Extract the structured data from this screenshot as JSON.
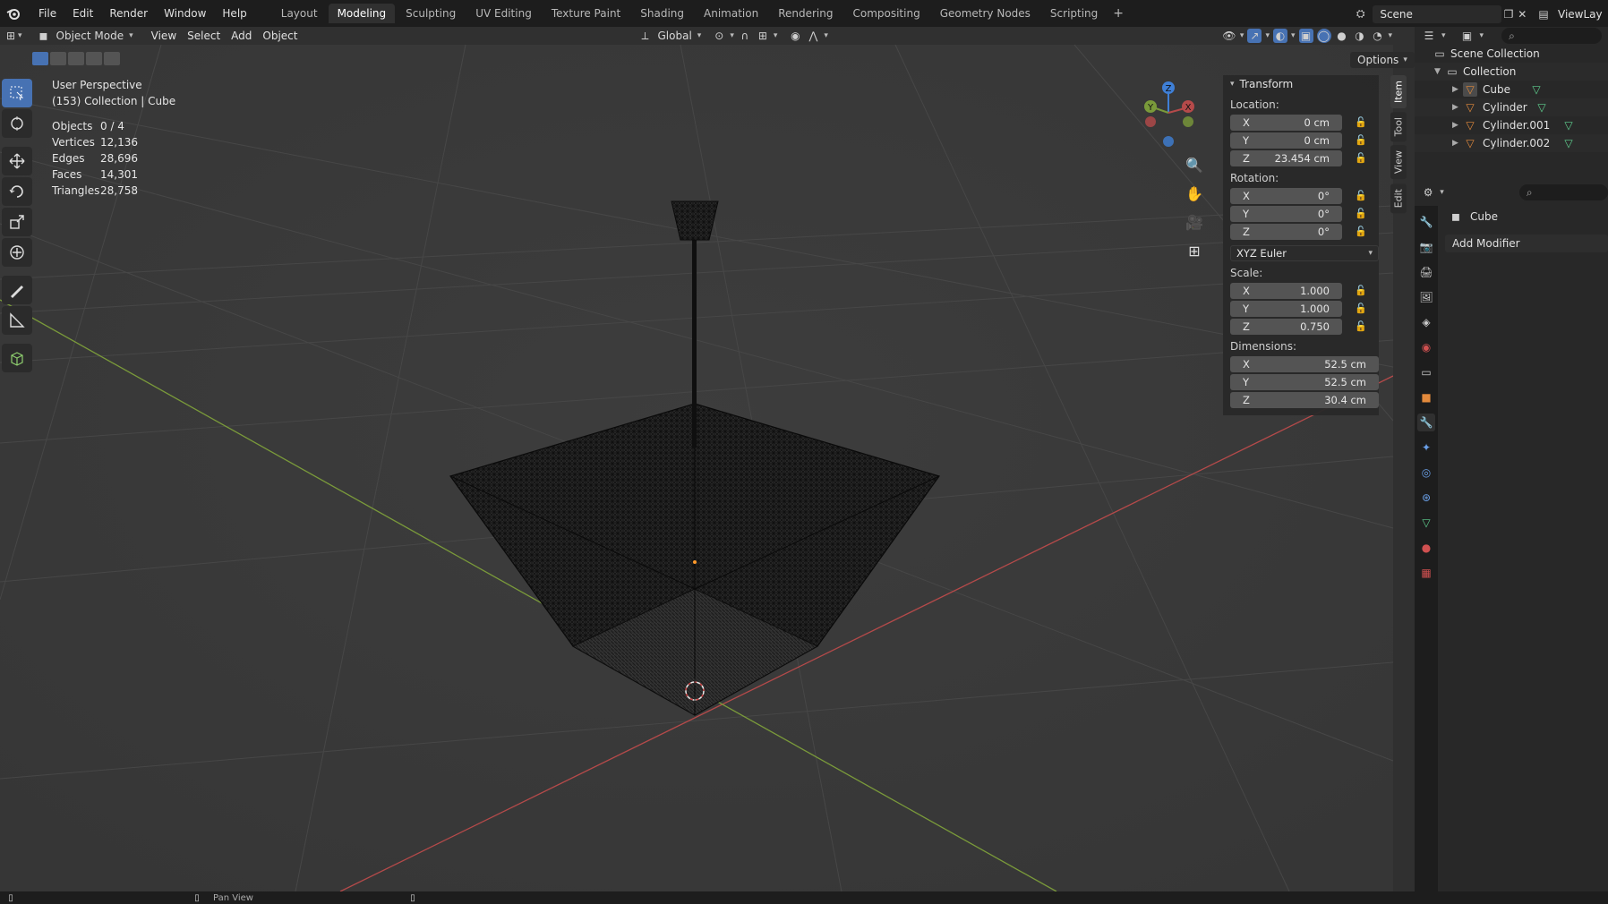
{
  "topbar": {
    "menus": [
      "File",
      "Edit",
      "Render",
      "Window",
      "Help"
    ],
    "workspaces": [
      "Layout",
      "Modeling",
      "Sculpting",
      "UV Editing",
      "Texture Paint",
      "Shading",
      "Animation",
      "Rendering",
      "Compositing",
      "Geometry Nodes",
      "Scripting"
    ],
    "active_workspace": "Modeling",
    "scene_name": "Scene",
    "view_layer": "ViewLay"
  },
  "viewport_header": {
    "mode": "Object Mode",
    "menus": [
      "View",
      "Select",
      "Add",
      "Object"
    ],
    "transform_orientation": "Global"
  },
  "viewport_overlay": {
    "perspective": "User Perspective",
    "context": "(153) Collection | Cube",
    "stats": [
      {
        "label": "Objects",
        "value": "0 / 4"
      },
      {
        "label": "Vertices",
        "value": "12,136"
      },
      {
        "label": "Edges",
        "value": "28,696"
      },
      {
        "label": "Faces",
        "value": "14,301"
      },
      {
        "label": "Triangles",
        "value": "28,758"
      }
    ]
  },
  "gizmo_labels": {
    "x": "X",
    "y": "Y",
    "z": "Z"
  },
  "options_label": "Options",
  "n_panel": {
    "title": "Transform",
    "location_label": "Location:",
    "location": [
      {
        "axis": "X",
        "value": "0 cm"
      },
      {
        "axis": "Y",
        "value": "0 cm"
      },
      {
        "axis": "Z",
        "value": "23.454 cm"
      }
    ],
    "rotation_label": "Rotation:",
    "rotation": [
      {
        "axis": "X",
        "value": "0°"
      },
      {
        "axis": "Y",
        "value": "0°"
      },
      {
        "axis": "Z",
        "value": "0°"
      }
    ],
    "rotation_mode": "XYZ Euler",
    "scale_label": "Scale:",
    "scale": [
      {
        "axis": "X",
        "value": "1.000"
      },
      {
        "axis": "Y",
        "value": "1.000"
      },
      {
        "axis": "Z",
        "value": "0.750"
      }
    ],
    "dimensions_label": "Dimensions:",
    "dimensions": [
      {
        "axis": "X",
        "value": "52.5 cm"
      },
      {
        "axis": "Y",
        "value": "52.5 cm"
      },
      {
        "axis": "Z",
        "value": "30.4 cm"
      }
    ],
    "tabs": [
      "Item",
      "Tool",
      "View",
      "Edit"
    ]
  },
  "outliner": {
    "root": "Scene Collection",
    "collection": "Collection",
    "objects": [
      "Cube",
      "Cylinder",
      "Cylinder.001",
      "Cylinder.002"
    ]
  },
  "properties": {
    "object_name": "Cube",
    "add_modifier": "Add Modifier"
  },
  "statusbar": {
    "hint": "Pan View"
  },
  "colors": {
    "accent": "#4772b3",
    "x_axis": "#b54a4a",
    "y_axis": "#7a9a3a",
    "z_axis": "#3f7fd6",
    "mesh_icon": "#e38a3c"
  }
}
